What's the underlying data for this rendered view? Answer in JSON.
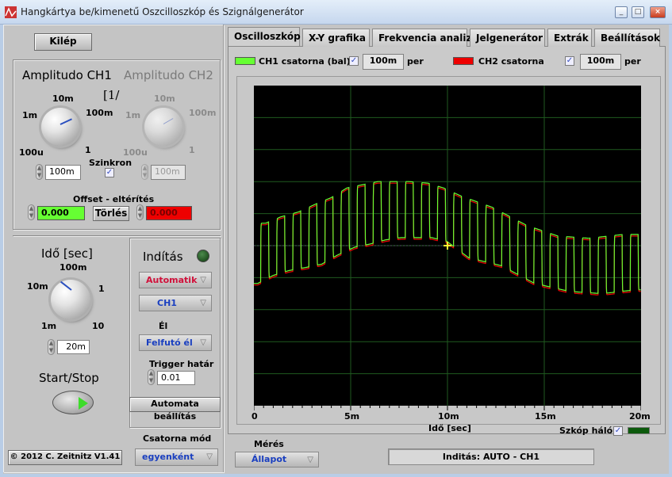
{
  "window": {
    "title": "Hangkártya be/kimenetű Oszcilloszkóp és Szignálgenerátor",
    "controls": [
      "minimize-icon",
      "maximize-icon",
      "close-icon"
    ]
  },
  "left": {
    "exit_label": "Kilép",
    "amplitude": {
      "ch1_title": "Amplitudo CH1",
      "ch2_title": "Amplitudo CH2",
      "unit_label": "[1/",
      "ticks": [
        "100u",
        "1m",
        "10m",
        "100m",
        "1"
      ],
      "ch1_value": "100m",
      "ch2_value": "100m",
      "sync_label": "Szinkron",
      "sync_checked": true,
      "offset_label": "Offset - eltérítés",
      "ch1_offset": "0.000",
      "ch2_offset": "0.000",
      "clear_label": "Törlés"
    },
    "time": {
      "title": "Idő [sec]",
      "ticks": [
        "1m",
        "10m",
        "100m",
        "1",
        "10"
      ],
      "value": "20m"
    },
    "startstop_label": "Start/Stop",
    "copyright": "© 2012   C. Zeitnitz V1.41",
    "trigger": {
      "title": "Indítás",
      "mode": "Automatik",
      "source": "CH1",
      "edge_label": "Él",
      "edge": "Felfutó él",
      "level_label": "Trigger határ",
      "level": "0.01",
      "auto_setup_label": "Automata beállítás"
    },
    "channel_mode_label": "Csatorna mód",
    "channel_mode": "egyenként"
  },
  "tabs": [
    {
      "label": "Oscilloszkóp",
      "active": true
    },
    {
      "label": "X-Y grafika",
      "active": false
    },
    {
      "label": "Frekvencia analiz.",
      "active": false
    },
    {
      "label": "Jelgenerátor",
      "active": false
    },
    {
      "label": "Extrák",
      "active": false
    },
    {
      "label": "Beállítások",
      "active": false
    }
  ],
  "scope": {
    "ch1_label": "CH1 csatorna (bal)",
    "ch1_checked": true,
    "ch1_scale": "100m",
    "ch2_label": "CH2 csatorna",
    "ch2_checked": true,
    "ch2_scale": "100m",
    "per_label": "per",
    "grid_label": "Szkóp háló",
    "grid_checked": true,
    "measure_label": "Mérés",
    "measure_value": "Állapot",
    "status": "Inditás: AUTO - CH1",
    "colors": {
      "ch1": "#66ff33",
      "ch2": "#ee0000",
      "grid": "#1f5a1f",
      "background": "#000000",
      "trigger_marker": "#ffff33"
    }
  },
  "chart_data": {
    "type": "line",
    "xlabel": "Idő [sec]",
    "x_tick_labels": [
      "0",
      "5m",
      "10m",
      "15m",
      "20m"
    ],
    "xlim_ms": [
      0,
      20
    ],
    "ylim_V": [
      -0.5,
      0.5
    ],
    "grid": true,
    "series": [
      {
        "name": "CH1 csatorna (bal)",
        "shape": "square wave",
        "period_ms": 0.83,
        "high_level": [
          [
            0.6,
            0.07
          ],
          [
            1.4,
            0.09
          ],
          [
            2.3,
            0.105
          ],
          [
            3.2,
            0.13
          ],
          [
            4.0,
            0.15
          ],
          [
            4.8,
            0.18
          ],
          [
            5.6,
            0.19
          ],
          [
            6.4,
            0.2
          ],
          [
            8.0,
            0.2
          ],
          [
            9.0,
            0.195
          ],
          [
            9.8,
            0.18
          ],
          [
            10.7,
            0.155
          ],
          [
            12.3,
            0.12
          ],
          [
            14.1,
            0.063
          ],
          [
            15.7,
            0.03
          ],
          [
            17.3,
            0.023
          ],
          [
            19.1,
            0.035
          ]
        ],
        "low_level": [
          [
            0.2,
            -0.118
          ],
          [
            1.0,
            -0.093
          ],
          [
            1.8,
            -0.078
          ],
          [
            2.7,
            -0.068
          ],
          [
            3.5,
            -0.058
          ],
          [
            4.3,
            -0.03
          ],
          [
            5.2,
            -0.005
          ],
          [
            6.0,
            0.005
          ],
          [
            6.8,
            0.018
          ],
          [
            7.6,
            0.025
          ],
          [
            9.2,
            0.025
          ],
          [
            10.0,
            0.012
          ],
          [
            11.1,
            -0.038
          ],
          [
            12.8,
            -0.063
          ],
          [
            14.5,
            -0.118
          ],
          [
            16.3,
            -0.143
          ],
          [
            18.0,
            -0.15
          ],
          [
            19.7,
            -0.138
          ]
        ]
      },
      {
        "name": "CH2 csatorna",
        "shape": "square wave",
        "follows": "CH1"
      }
    ],
    "trigger_point": {
      "t_ms": 10,
      "V": 0.0
    }
  }
}
